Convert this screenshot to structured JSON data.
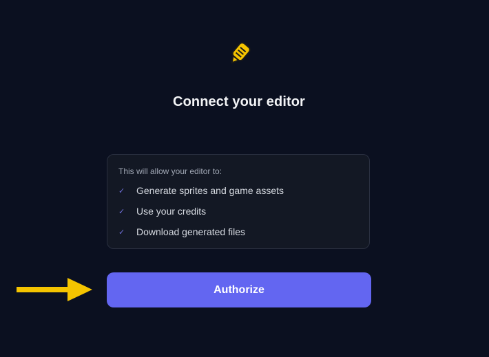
{
  "header": {
    "logo_icon": "pencil-hash-icon",
    "title": "Connect your editor"
  },
  "permissions": {
    "heading": "This will allow your editor to:",
    "items": [
      {
        "icon": "check-icon",
        "label": "Generate sprites and game assets"
      },
      {
        "icon": "check-icon",
        "label": "Use your credits"
      },
      {
        "icon": "check-icon",
        "label": "Download generated files"
      }
    ]
  },
  "actions": {
    "authorize_label": "Authorize"
  },
  "annotation": {
    "icon": "arrow-right-icon",
    "color": "#f5c400"
  },
  "colors": {
    "background": "#0b1020",
    "accent": "#6366f1",
    "logo": "#f5c400"
  },
  "check_glyph": "✓"
}
